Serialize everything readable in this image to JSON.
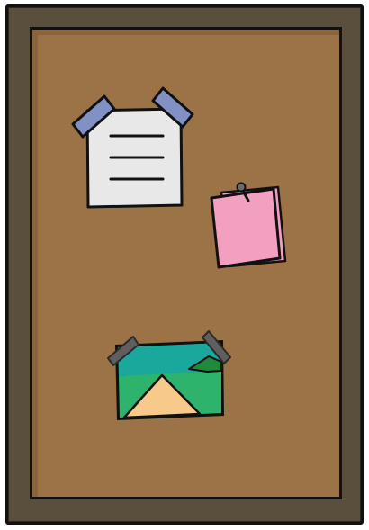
{
  "board": {
    "frame_color": "#5a4e3c",
    "cork_color": "#9c7346",
    "outline_color": "#111111"
  },
  "items": {
    "note": {
      "kind": "note-card",
      "paper_color": "#e8e8e8",
      "tape_color": "#8191c4",
      "text_lines": 3
    },
    "sticky": {
      "kind": "sticky-note-stack",
      "paper_color": "#f3a0c0",
      "pin_color": "#6b6b6b"
    },
    "photo": {
      "kind": "landscape-photo",
      "sky_color": "#1aa79c",
      "ground_color": "#2db36b",
      "hill_color": "#1f8a3c",
      "path_color": "#f7c98b",
      "tape_color": "#5f5f5f"
    }
  }
}
